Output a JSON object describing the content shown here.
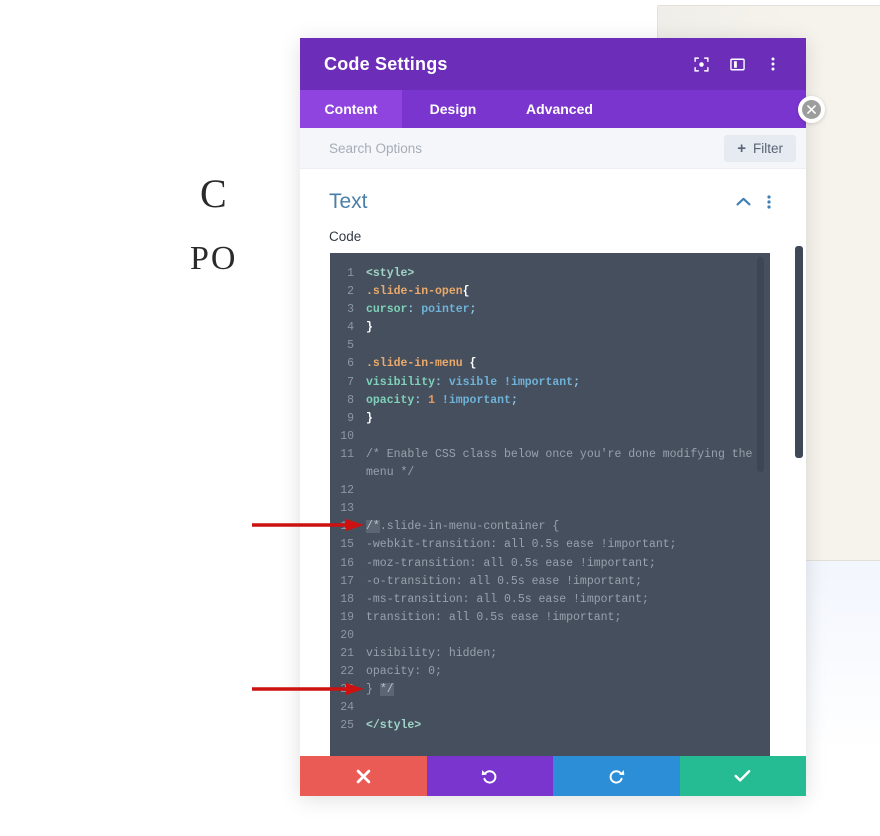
{
  "background": {
    "headline": "C",
    "subhead": "PO",
    "close_icon": "close-circle-icon"
  },
  "modal": {
    "title": "Code Settings",
    "header_icons": [
      {
        "name": "focus-target-icon"
      },
      {
        "name": "layout-panel-icon"
      },
      {
        "name": "more-vertical-icon"
      }
    ],
    "tabs": [
      {
        "label": "Content",
        "active": true
      },
      {
        "label": "Design",
        "active": false
      },
      {
        "label": "Advanced",
        "active": false
      }
    ],
    "search": {
      "placeholder": "Search Options",
      "value": ""
    },
    "filter_button": {
      "label": "Filter",
      "icon": "plus-icon"
    },
    "section": {
      "title": "Text",
      "collapse_icon": "chevron-up-icon",
      "menu_icon": "more-vertical-icon",
      "field_label": "Code"
    },
    "footer_buttons": [
      {
        "name": "cancel-button",
        "icon": "close-icon",
        "color": "#eb5b56"
      },
      {
        "name": "undo-button",
        "icon": "undo-icon",
        "color": "#7b35cf"
      },
      {
        "name": "redo-button",
        "icon": "redo-icon",
        "color": "#2c8ed6"
      },
      {
        "name": "save-button",
        "icon": "check-icon",
        "color": "#25bc93"
      }
    ]
  },
  "code": {
    "language": "html-css",
    "lines": [
      {
        "n": 1,
        "tokens": [
          {
            "t": "<style>",
            "c": "tok-tag"
          }
        ]
      },
      {
        "n": 2,
        "tokens": [
          {
            "t": ".slide-in-open",
            "c": "tok-sel"
          },
          {
            "t": "{",
            "c": "tok-brace"
          }
        ]
      },
      {
        "n": 3,
        "tokens": [
          {
            "t": "cursor",
            "c": "tok-prop"
          },
          {
            "t": ": ",
            "c": "tok-punc"
          },
          {
            "t": "pointer",
            "c": "tok-val"
          },
          {
            "t": ";",
            "c": "tok-punc"
          }
        ]
      },
      {
        "n": 4,
        "tokens": [
          {
            "t": "}",
            "c": "tok-brace"
          }
        ]
      },
      {
        "n": 5,
        "tokens": []
      },
      {
        "n": 6,
        "tokens": [
          {
            "t": ".slide-in-menu ",
            "c": "tok-sel"
          },
          {
            "t": "{",
            "c": "tok-brace"
          }
        ]
      },
      {
        "n": 7,
        "tokens": [
          {
            "t": "visibility",
            "c": "tok-prop"
          },
          {
            "t": ": ",
            "c": "tok-punc"
          },
          {
            "t": "visible !important",
            "c": "tok-val"
          },
          {
            "t": ";",
            "c": "tok-punc"
          }
        ]
      },
      {
        "n": 8,
        "tokens": [
          {
            "t": "opacity",
            "c": "tok-prop"
          },
          {
            "t": ": ",
            "c": "tok-punc"
          },
          {
            "t": "1",
            "c": "tok-num"
          },
          {
            "t": " !important",
            "c": "tok-val"
          },
          {
            "t": ";",
            "c": "tok-punc"
          }
        ]
      },
      {
        "n": 9,
        "tokens": [
          {
            "t": "}",
            "c": "tok-brace"
          }
        ]
      },
      {
        "n": 10,
        "tokens": []
      },
      {
        "n": 11,
        "tokens": [
          {
            "t": "/* Enable CSS class below once you're done modifying the menu */",
            "c": "tok-comment"
          }
        ]
      },
      {
        "n": 12,
        "tokens": []
      },
      {
        "n": 13,
        "tokens": []
      },
      {
        "n": 14,
        "tokens": [
          {
            "t": "/*",
            "c": "tok-comment tok-hl"
          },
          {
            "t": ".slide-in-menu-container {",
            "c": "tok-comment"
          }
        ]
      },
      {
        "n": 15,
        "tokens": [
          {
            "t": "-webkit-transition: all 0.5s ease !important;",
            "c": "tok-comment"
          }
        ]
      },
      {
        "n": 16,
        "tokens": [
          {
            "t": "-moz-transition: all 0.5s ease !important;",
            "c": "tok-comment"
          }
        ]
      },
      {
        "n": 17,
        "tokens": [
          {
            "t": "-o-transition: all 0.5s ease !important;",
            "c": "tok-comment"
          }
        ]
      },
      {
        "n": 18,
        "tokens": [
          {
            "t": "-ms-transition: all 0.5s ease !important;",
            "c": "tok-comment"
          }
        ]
      },
      {
        "n": 19,
        "tokens": [
          {
            "t": "transition: all 0.5s ease !important;",
            "c": "tok-comment"
          }
        ]
      },
      {
        "n": 20,
        "tokens": []
      },
      {
        "n": 21,
        "tokens": [
          {
            "t": "visibility: hidden;",
            "c": "tok-comment"
          }
        ]
      },
      {
        "n": 22,
        "tokens": [
          {
            "t": "opacity: 0;",
            "c": "tok-comment"
          }
        ]
      },
      {
        "n": 23,
        "tokens": [
          {
            "t": "} ",
            "c": "tok-comment"
          },
          {
            "t": "*/",
            "c": "tok-comment tok-hl"
          }
        ]
      },
      {
        "n": 24,
        "tokens": []
      },
      {
        "n": 25,
        "tokens": [
          {
            "t": "</style>",
            "c": "tok-tag"
          }
        ]
      }
    ]
  },
  "annotations": {
    "arrows": [
      {
        "name": "arrow-to-line-14",
        "target_line": 14,
        "color": "#cc1111"
      },
      {
        "name": "arrow-to-line-23",
        "target_line": 23,
        "color": "#cc1111"
      }
    ]
  }
}
